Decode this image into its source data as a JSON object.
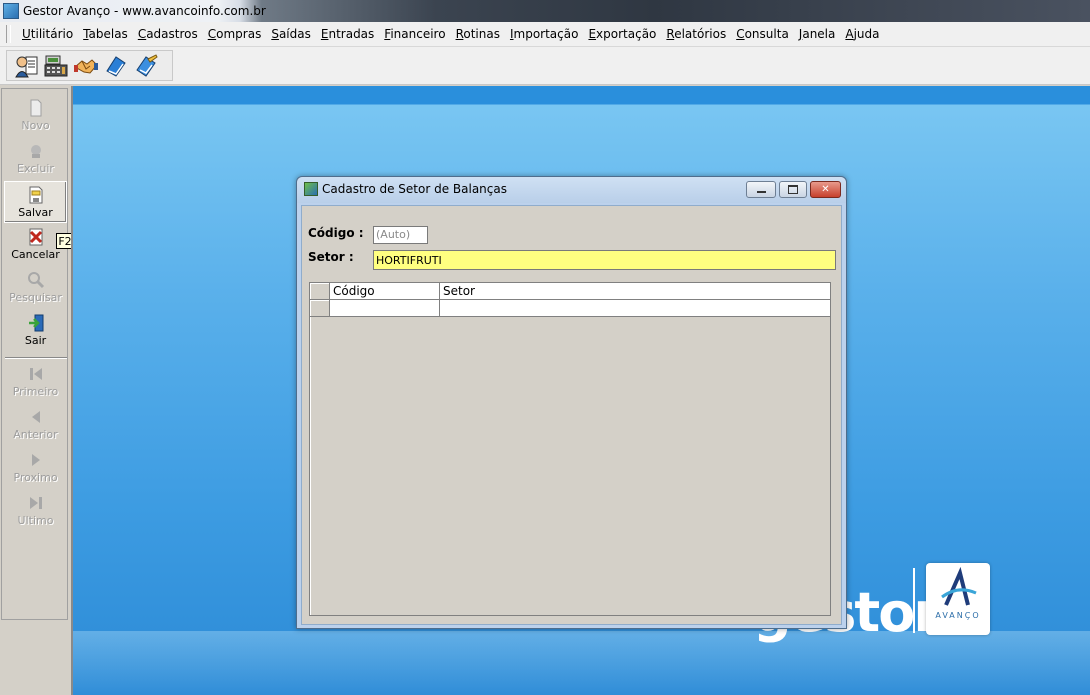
{
  "window": {
    "title": "Gestor Avanço - www.avancoinfo.com.br"
  },
  "menubar": {
    "items": [
      "Utilitário",
      "Tabelas",
      "Cadastros",
      "Compras",
      "Saídas",
      "Entradas",
      "Financeiro",
      "Rotinas",
      "Importação",
      "Exportação",
      "Relatórios",
      "Consulta",
      "Janela",
      "Ajuda"
    ]
  },
  "toolbar": {
    "icons": [
      "user-agenda-icon",
      "cash-register-icon",
      "handshake-icon",
      "blue-book-icon",
      "edit-book-icon"
    ]
  },
  "leftpanel": {
    "buttons": [
      {
        "label": "Novo",
        "icon": "new-document-icon",
        "enabled": false
      },
      {
        "label": "Excluir",
        "icon": "delete-icon",
        "enabled": false
      },
      {
        "label": "Salvar",
        "icon": "save-icon",
        "enabled": true,
        "active": true
      },
      {
        "label": "Cancelar",
        "icon": "cancel-icon",
        "enabled": true
      },
      {
        "label": "Pesquisar",
        "icon": "search-icon",
        "enabled": false
      },
      {
        "label": "Sair",
        "icon": "exit-icon",
        "enabled": true
      },
      {
        "label": "Primeiro",
        "icon": "first-record-icon",
        "enabled": false
      },
      {
        "label": "Anterior",
        "icon": "previous-record-icon",
        "enabled": false
      },
      {
        "label": "Proximo",
        "icon": "next-record-icon",
        "enabled": false
      },
      {
        "label": "Ultimo",
        "icon": "last-record-icon",
        "enabled": false
      }
    ],
    "tooltip": "F2"
  },
  "dialog": {
    "title": "Cadastro de Setor de Balanças",
    "codigo_label": "Código :",
    "codigo_value": "(Auto)",
    "setor_label": "Setor :",
    "setor_value": "HORTIFRUTI",
    "grid": {
      "columns": [
        "Código",
        "Setor"
      ],
      "rows": [
        [
          "",
          ""
        ]
      ]
    }
  },
  "brand": {
    "text": "gestor",
    "logo_text": "AVANÇO"
  },
  "colors": {
    "field_highlight": "#ffff80",
    "workspace": "#5bb1eb"
  }
}
